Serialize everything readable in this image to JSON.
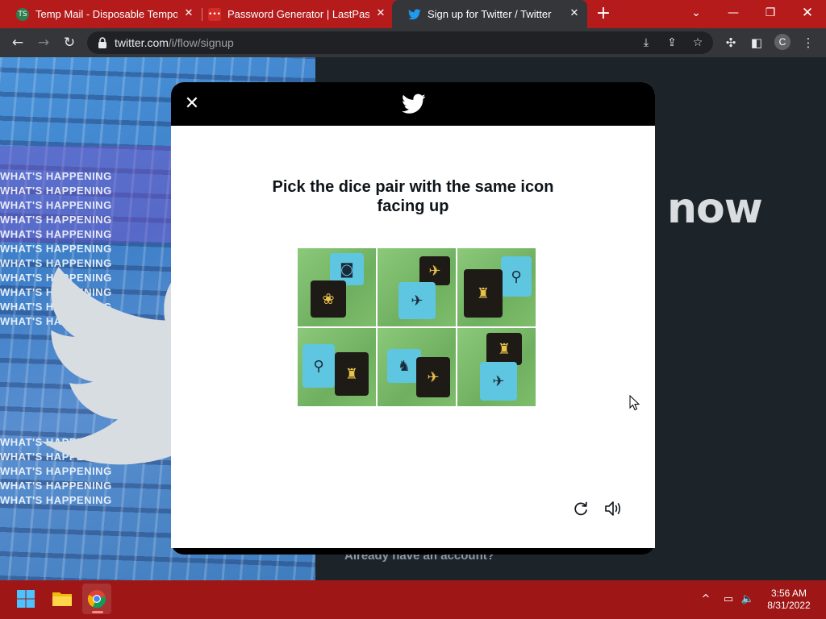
{
  "tabs": [
    {
      "title": "Temp Mail - Disposable Tempora",
      "favicon": "tempmail-icon"
    },
    {
      "title": "Password Generator | LastPass",
      "favicon": "lastpass-icon"
    },
    {
      "title": "Sign up for Twitter / Twitter",
      "favicon": "twitter-icon",
      "active": true
    }
  ],
  "address_bar": {
    "host": "twitter.com",
    "path": "/i/flow/signup"
  },
  "profile_initial": "C",
  "page": {
    "headline_fragment": "now",
    "have_account_text": "Already have an account?",
    "bg_pattern_text": "WHAT'S HAPPENING"
  },
  "modal": {
    "prompt": "Pick the dice pair with the same icon facing up",
    "captcha_tiles": [
      {
        "index": 1
      },
      {
        "index": 2
      },
      {
        "index": 3
      },
      {
        "index": 4
      },
      {
        "index": 5
      },
      {
        "index": 6
      }
    ]
  },
  "taskbar": {
    "time": "3:56 AM",
    "date": "8/31/2022",
    "apps": [
      "start-icon",
      "file-explorer-icon",
      "chrome-icon"
    ]
  },
  "colors": {
    "tabbar": "#b51b1b",
    "toolbar": "#35363a",
    "taskbar": "#9e1616",
    "twitter_blue": "#1d9bf0"
  }
}
